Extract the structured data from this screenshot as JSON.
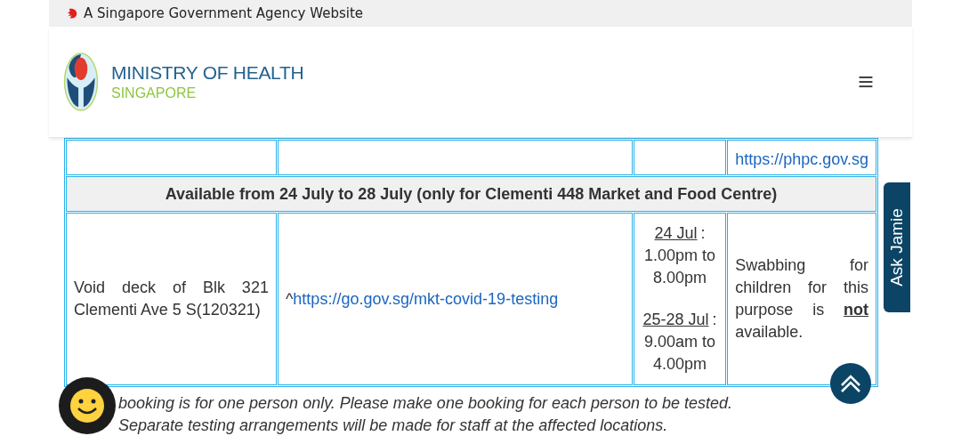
{
  "gov_banner": {
    "text": "A Singapore Government Agency Website"
  },
  "header": {
    "logo_title": "MINISTRY OF HEALTH",
    "logo_subtitle": "SINGAPORE"
  },
  "table": {
    "partial_row": {
      "link": "https://phpc.gov.sg"
    },
    "section_heading": "Available from 24 July to 28 July (only for Clementi 448 Market and Food Centre)",
    "rows": [
      {
        "location": "Void deck of Blk 321 Clementi Ave 5 S(120321)",
        "booking_prefix": "^",
        "booking_link": "https://go.gov.sg/mkt-covid-19-testing",
        "slots": [
          {
            "date": "24 Jul",
            "separator": ":",
            "time": "1.00pm to 8.00pm"
          },
          {
            "date": "25-28 Jul",
            "separator": ":",
            "time": "9.00am to 4.00pm"
          }
        ],
        "remarks": "Swabbing for children for this purpose is **not** available."
      }
    ]
  },
  "notes": [
    "booking is for one person only. Please make one booking for each person to be tested.",
    "Separate testing arrangements will be made for staff at the affected locations."
  ],
  "ask_jamie": {
    "label": "Ask Jamie"
  }
}
